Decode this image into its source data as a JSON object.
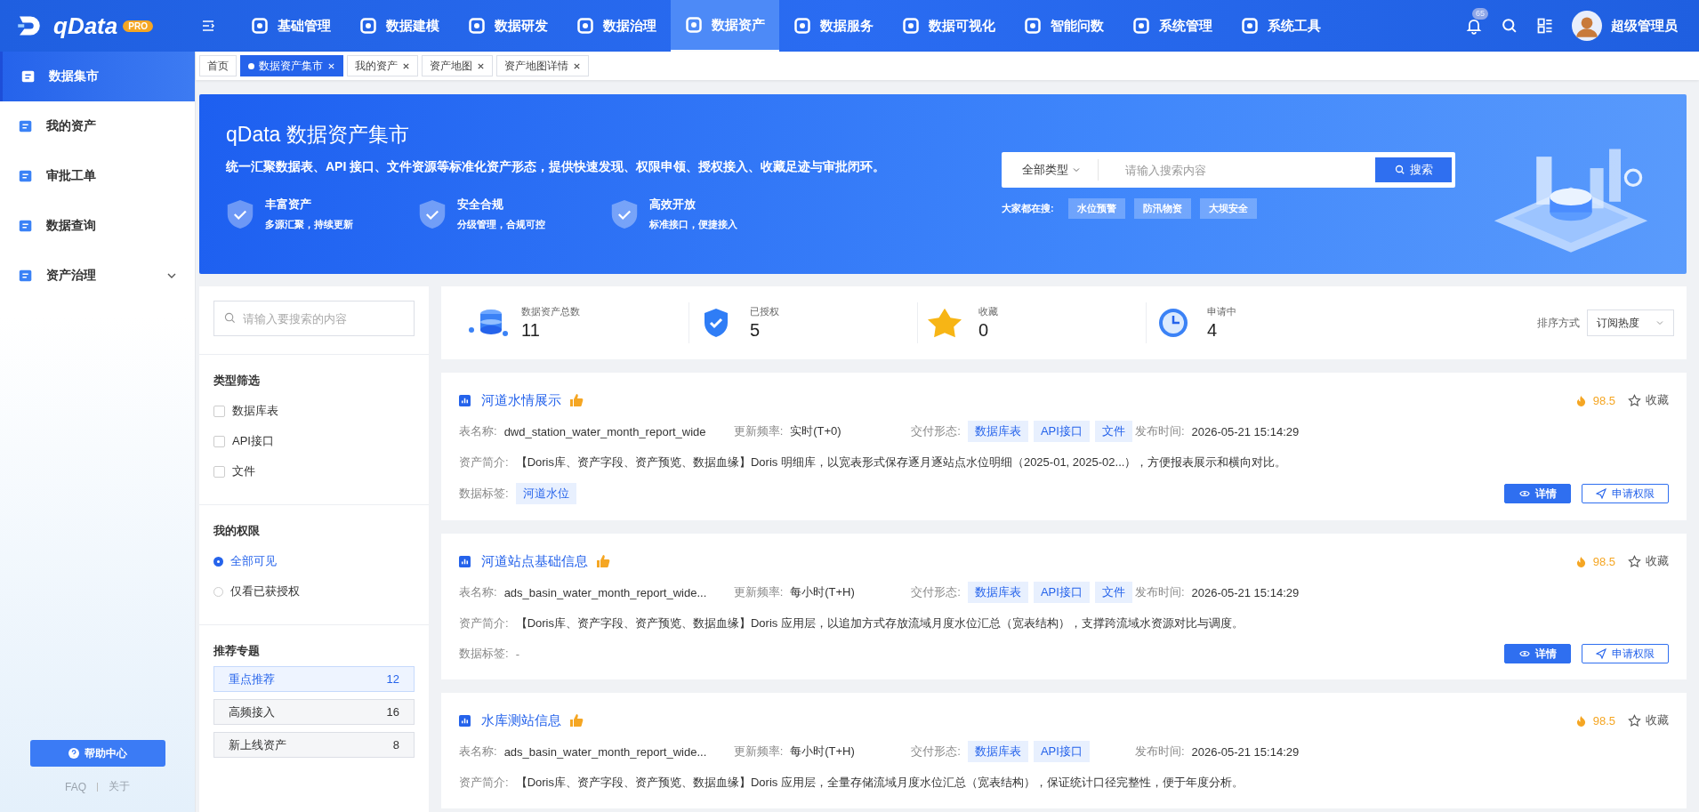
{
  "brand": {
    "name": "qData",
    "badge": "PRO"
  },
  "nav": [
    {
      "label": "基础管理",
      "selected": false
    },
    {
      "label": "数据建模",
      "selected": false
    },
    {
      "label": "数据研发",
      "selected": false
    },
    {
      "label": "数据治理",
      "selected": false
    },
    {
      "label": "数据资产",
      "selected": true
    },
    {
      "label": "数据服务",
      "selected": false
    },
    {
      "label": "数据可视化",
      "selected": false
    },
    {
      "label": "智能问数",
      "selected": false
    },
    {
      "label": "系统管理",
      "selected": false
    },
    {
      "label": "系统工具",
      "selected": false
    }
  ],
  "header": {
    "notification_count": "65",
    "user": "超级管理员"
  },
  "sidebar": {
    "items": [
      {
        "label": "数据集市",
        "selected": true,
        "kind": "link"
      },
      {
        "label": "我的资产",
        "selected": false,
        "kind": "link"
      },
      {
        "label": "审批工单",
        "selected": false,
        "kind": "link"
      },
      {
        "label": "数据查询",
        "selected": false,
        "kind": "link"
      },
      {
        "label": "资产治理",
        "selected": false,
        "kind": "group",
        "expanded": false
      }
    ],
    "help_button": "帮助中心",
    "links": [
      "FAQ",
      "关于"
    ]
  },
  "tabs": [
    {
      "label": "首页",
      "selected": false,
      "closable": false
    },
    {
      "label": "数据资产集市",
      "selected": true,
      "closable": true
    },
    {
      "label": "我的资产",
      "selected": false,
      "closable": true
    },
    {
      "label": "资产地图",
      "selected": false,
      "closable": true
    },
    {
      "label": "资产地图详情",
      "selected": false,
      "closable": true
    }
  ],
  "banner": {
    "title": "qData 数据资产集市",
    "subtitle": "统一汇聚数据表、API 接口、文件资源等标准化资产形态，提供快速发现、权限申领、授权接入、收藏足迹与审批闭环。",
    "features": [
      {
        "title": "丰富资产",
        "desc": "多源汇聚，持续更新"
      },
      {
        "title": "安全合规",
        "desc": "分级管理，合规可控"
      },
      {
        "title": "高效开放",
        "desc": "标准接口，便捷接入"
      }
    ],
    "search": {
      "type": "全部类型",
      "placeholder": "请输入搜索内容",
      "button": "搜索"
    },
    "hot_label": "大家都在搜:",
    "hot_tags": [
      "水位预警",
      "防汛物资",
      "大坝安全"
    ]
  },
  "filter_search": {
    "placeholder": "请输入要搜索的内容"
  },
  "type_filter": {
    "title": "类型筛选",
    "options": [
      {
        "label": "数据库表",
        "checked": false
      },
      {
        "label": "API接口",
        "checked": false
      },
      {
        "label": "文件",
        "checked": false
      }
    ]
  },
  "permission": {
    "title": "我的权限",
    "options": [
      {
        "label": "全部可见",
        "selected": true
      },
      {
        "label": "仅看已获授权",
        "selected": false
      }
    ]
  },
  "topics": {
    "title": "推荐专题",
    "items": [
      {
        "label": "重点推荐",
        "count": "12",
        "selected": true
      },
      {
        "label": "高频接入",
        "count": "16",
        "selected": false
      },
      {
        "label": "新上线资产",
        "count": "8",
        "selected": false
      }
    ]
  },
  "stats": [
    {
      "kind": "total",
      "label": "数据资产总数",
      "value": "11"
    },
    {
      "kind": "authorized",
      "label": "已授权",
      "value": "5"
    },
    {
      "kind": "favorite",
      "label": "收藏",
      "value": "0"
    },
    {
      "kind": "pending",
      "label": "申请中",
      "value": "4"
    }
  ],
  "sort": {
    "label": "排序方式",
    "value": "订阅热度"
  },
  "assets": [
    {
      "title": "河道水情展示",
      "heat": "98.5",
      "favorite_label": "收藏",
      "table_label": "表名称:",
      "table_name": "dwd_station_water_month_report_wide",
      "freq_label": "更新频率:",
      "freq": "实时(T+0)",
      "delivery_label": "交付形态:",
      "delivery": [
        "数据库表",
        "API接口",
        "文件"
      ],
      "publish_label": "发布时间:",
      "publish_time": "2026-05-21 15:14:29",
      "desc_label": "资产简介:",
      "desc": "【Doris库、资产字段、资产预览、数据血缘】Doris 明细库，以宽表形式保存逐月逐站点水位明细（2025-01, 2025-02...），方便报表展示和横向对比。",
      "tags_label": "数据标签:",
      "tags": [
        "河道水位"
      ],
      "buttons": [
        "详情",
        "申请权限"
      ]
    },
    {
      "title": "河道站点基础信息",
      "heat": "98.5",
      "favorite_label": "收藏",
      "table_label": "表名称:",
      "table_name": "ads_basin_water_month_report_wide...",
      "freq_label": "更新频率:",
      "freq": "每小时(T+H)",
      "delivery_label": "交付形态:",
      "delivery": [
        "数据库表",
        "API接口",
        "文件"
      ],
      "publish_label": "发布时间:",
      "publish_time": "2026-05-21 15:14:29",
      "desc_label": "资产简介:",
      "desc": "【Doris库、资产字段、资产预览、数据血缘】Doris 应用层，以追加方式存放流域月度水位汇总（宽表结构），支撑跨流域水资源对比与调度。",
      "tags_label": "数据标签:",
      "no_tags": "-",
      "buttons": [
        "详情",
        "申请权限"
      ]
    },
    {
      "title": "水库测站信息",
      "heat": "98.5",
      "favorite_label": "收藏",
      "table_label": "表名称:",
      "table_name": "ads_basin_water_month_report_wide...",
      "freq_label": "更新频率:",
      "freq": "每小时(T+H)",
      "delivery_label": "交付形态:",
      "delivery": [
        "数据库表",
        "API接口"
      ],
      "publish_label": "发布时间:",
      "publish_time": "2026-05-21 15:14:29",
      "desc_label": "资产简介:",
      "desc": "【Doris库、资产字段、资产预览、数据血缘】Doris 应用层，全量存储流域月度水位汇总（宽表结构），保证统计口径完整性，便于年度分析。"
    }
  ]
}
